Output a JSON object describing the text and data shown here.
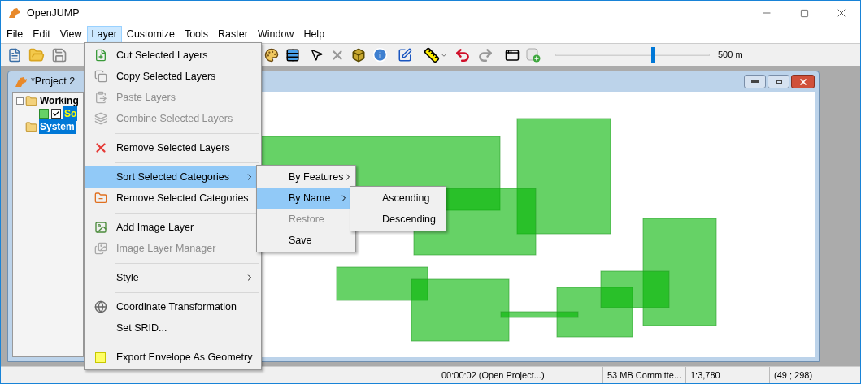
{
  "window": {
    "title": "OpenJUMP"
  },
  "menu_bar": [
    {
      "label": "File",
      "selected": false
    },
    {
      "label": "Edit",
      "selected": false
    },
    {
      "label": "View",
      "selected": false
    },
    {
      "label": "Layer",
      "selected": true
    },
    {
      "label": "Customize",
      "selected": false
    },
    {
      "label": "Tools",
      "selected": false
    },
    {
      "label": "Raster",
      "selected": false
    },
    {
      "label": "Window",
      "selected": false
    },
    {
      "label": "Help",
      "selected": false
    }
  ],
  "toolbar": {
    "scale": {
      "level": 0.63,
      "reading": "500 m"
    }
  },
  "project": {
    "title": "*Project 2",
    "tree": [
      {
        "label": "Working",
        "selected": false,
        "expanded": true,
        "children": [
          {
            "label": "So",
            "selected": true,
            "checked": true
          }
        ]
      },
      {
        "label": "System",
        "selected": true
      }
    ]
  },
  "layer_menu": [
    {
      "kind": "item",
      "label": "Cut Selected Layers",
      "disabled": false,
      "selected": false,
      "submenu": false
    },
    {
      "kind": "item",
      "label": "Copy Selected Layers",
      "disabled": false,
      "selected": false,
      "submenu": false
    },
    {
      "kind": "item",
      "label": "Paste Layers",
      "disabled": true,
      "selected": false,
      "submenu": false
    },
    {
      "kind": "item",
      "label": "Combine Selected Layers",
      "disabled": true,
      "selected": false,
      "submenu": false
    },
    {
      "kind": "separator"
    },
    {
      "kind": "item",
      "label": "Remove Selected Layers",
      "disabled": false,
      "selected": false,
      "submenu": false
    },
    {
      "kind": "separator"
    },
    {
      "kind": "item",
      "label": "Sort Selected Categories",
      "disabled": false,
      "selected": true,
      "submenu": true
    },
    {
      "kind": "item",
      "label": "Remove Selected Categories",
      "disabled": false,
      "selected": false,
      "submenu": false
    },
    {
      "kind": "separator"
    },
    {
      "kind": "item",
      "label": "Add Image Layer",
      "disabled": false,
      "selected": false,
      "submenu": false
    },
    {
      "kind": "item",
      "label": "Image Layer Manager",
      "disabled": true,
      "selected": false,
      "submenu": false
    },
    {
      "kind": "separator"
    },
    {
      "kind": "item",
      "label": "Style",
      "disabled": false,
      "selected": false,
      "submenu": true
    },
    {
      "kind": "separator"
    },
    {
      "kind": "item",
      "label": "Coordinate Transformation",
      "disabled": false,
      "selected": false,
      "submenu": false
    },
    {
      "kind": "item",
      "label": "Set SRID...",
      "disabled": false,
      "selected": false,
      "submenu": false
    },
    {
      "kind": "separator"
    },
    {
      "kind": "item",
      "label": "Export Envelope As Geometry",
      "disabled": false,
      "selected": false,
      "submenu": false
    }
  ],
  "sort_menu": [
    {
      "label": "By Features",
      "disabled": false,
      "selected": false,
      "submenu": true
    },
    {
      "label": "By Name",
      "disabled": false,
      "selected": true,
      "submenu": true
    },
    {
      "label": "Restore",
      "disabled": true,
      "selected": false,
      "submenu": false
    },
    {
      "label": "Save",
      "disabled": false,
      "selected": false,
      "submenu": false
    }
  ],
  "order_menu": [
    {
      "label": "Ascending",
      "selected": false
    },
    {
      "label": "Descending",
      "selected": false
    }
  ],
  "status_bar": [
    "00:00:02 (Open Project...)",
    "53 MB Committe...",
    "1:3,780",
    "(49 ; 298)"
  ]
}
